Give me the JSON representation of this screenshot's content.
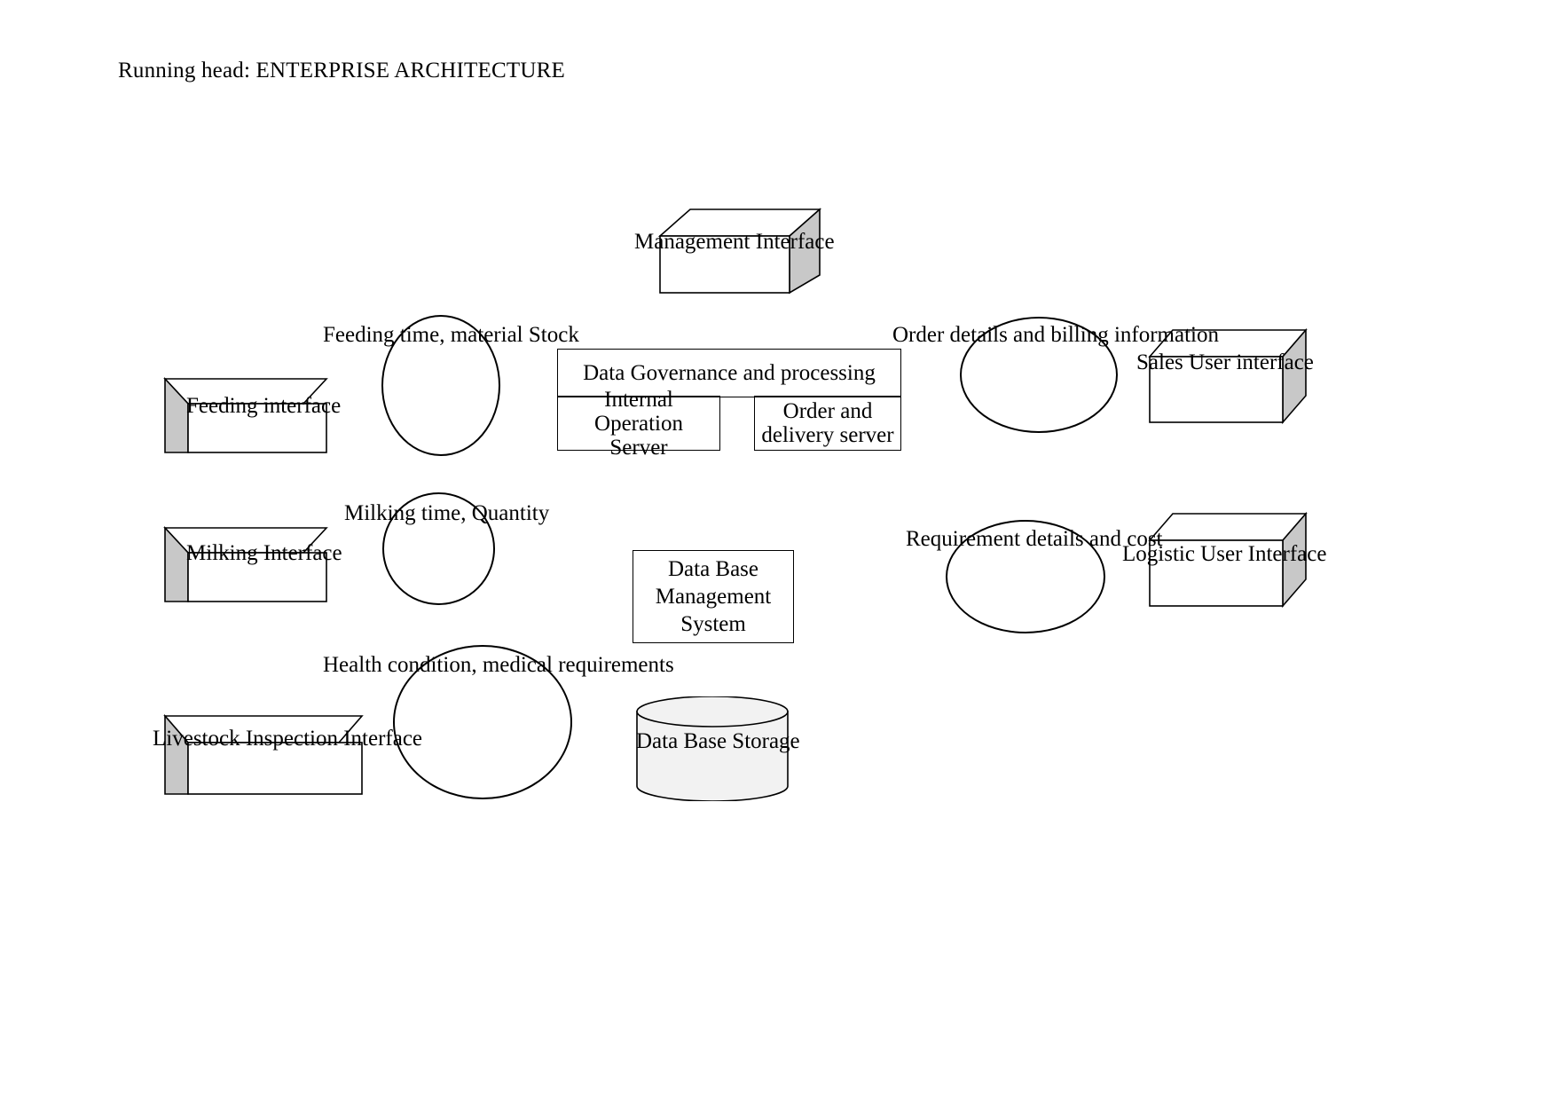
{
  "page": {
    "running_head": "Running head: ENTERPRISE ARCHITECTURE",
    "background_color": "#ffffff",
    "stroke_color": "#000000",
    "box_side_fill": "#c8c8c8",
    "cylinder_fill": "#f2f2f2"
  },
  "diagram": {
    "title": "Enterprise Architecture Diagram",
    "nodes": {
      "management_interface": {
        "label": "Management Interface",
        "shape": "3d-box"
      },
      "feeding_interface": {
        "label": "Feeding interface",
        "shape": "3d-box"
      },
      "milking_interface": {
        "label": "Milking Interface",
        "shape": "3d-box"
      },
      "livestock_inspection_interface": {
        "label": "Livestock Inspection Interface",
        "shape": "3d-box"
      },
      "sales_user_interface": {
        "label": "Sales User interface",
        "shape": "3d-box"
      },
      "logistic_user_interface": {
        "label": "Logistic User Interface",
        "shape": "3d-box"
      },
      "data_governance": {
        "label": "Data Governance and processing",
        "shape": "container"
      },
      "internal_operation_server": {
        "label": "Internal Operation Server",
        "shape": "rect"
      },
      "order_and_delivery_server": {
        "label": "Order and delivery server",
        "shape": "rect"
      },
      "database_management_system": {
        "label": "Data Base Management System",
        "shape": "rect"
      },
      "database_storage": {
        "label": "Data Base Storage",
        "shape": "cylinder"
      }
    },
    "flow_labels": [
      {
        "id": "feeding-flow",
        "text": "Feeding time, material Stock"
      },
      {
        "id": "milking-flow",
        "text": "Milking time, Quantity"
      },
      {
        "id": "health-flow",
        "text": "Health condition, medical requirements"
      },
      {
        "id": "order-flow",
        "text": "Order details and billing information"
      },
      {
        "id": "requirement-flow",
        "text": "Requirement details and cost"
      }
    ],
    "connectors": [
      {
        "id": "feeding-connector",
        "shape": "ellipse"
      },
      {
        "id": "milking-connector",
        "shape": "ellipse"
      },
      {
        "id": "health-connector",
        "shape": "ellipse"
      },
      {
        "id": "order-connector",
        "shape": "ellipse"
      },
      {
        "id": "requirement-connector",
        "shape": "ellipse"
      }
    ]
  }
}
